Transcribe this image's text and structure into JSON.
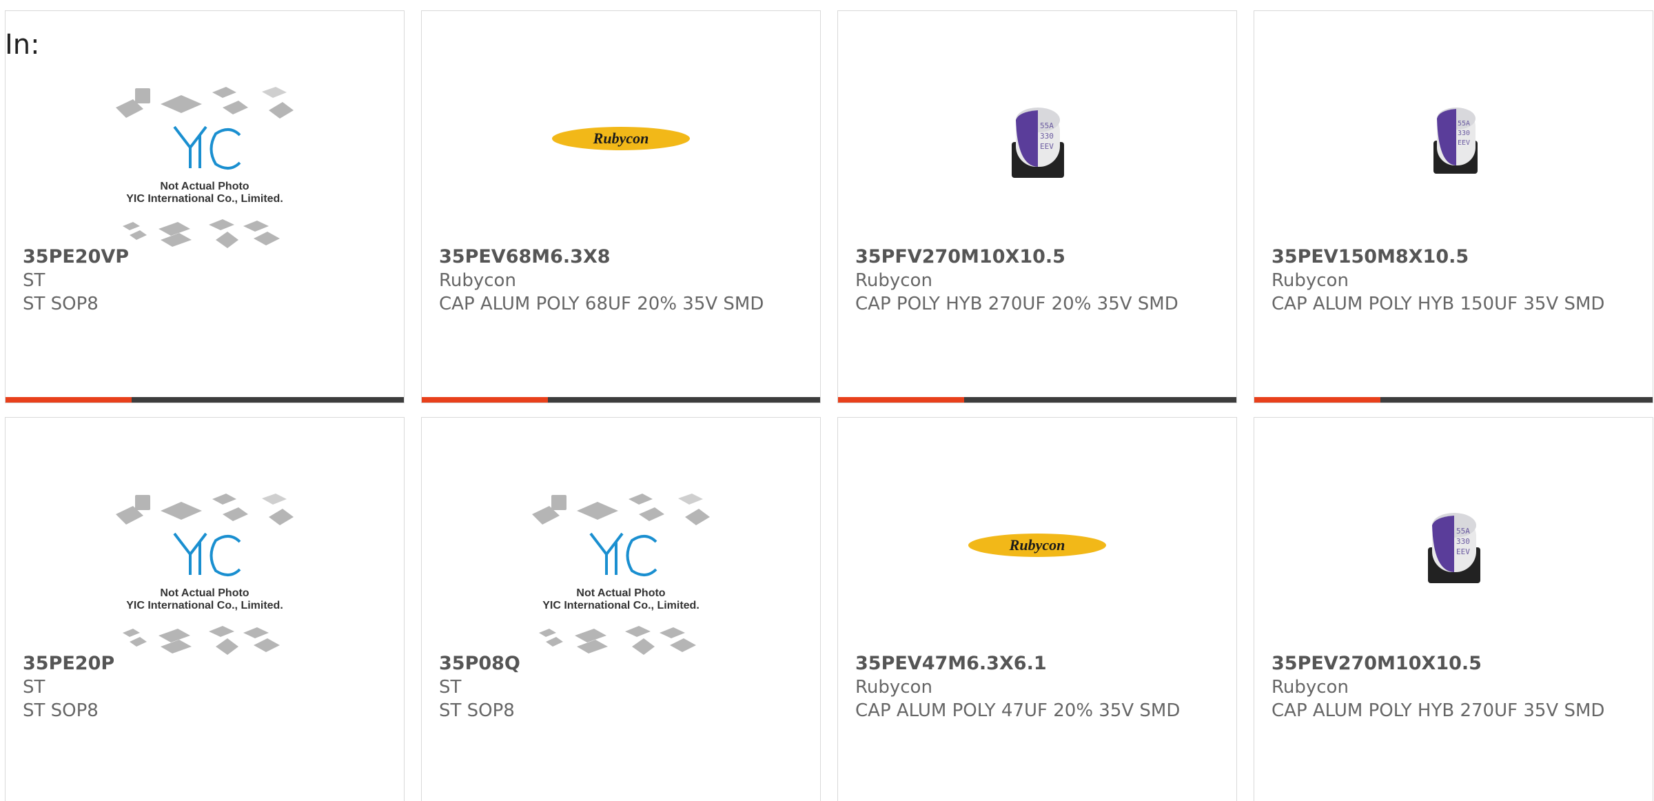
{
  "filter": {
    "label": "In:"
  },
  "cards": [
    {
      "part": "35PE20VP",
      "maker": "ST",
      "desc": "ST SOP8",
      "image": "not-actual-photo",
      "placeholder": {
        "line1": "Not Actual Photo",
        "line2": "YIC International Co., Limited."
      }
    },
    {
      "part": "35PEV68M6.3X8",
      "maker": "Rubycon",
      "desc": "CAP ALUM POLY 68UF 20% 35V SMD",
      "image": "rubycon-logo",
      "logo_text": "Rubycon"
    },
    {
      "part": "35PFV270M10X10.5",
      "maker": "Rubycon",
      "desc": "CAP POLY HYB 270UF 20% 35V SMD",
      "image": "capacitor-photo"
    },
    {
      "part": "35PEV150M8X10.5",
      "maker": "Rubycon",
      "desc": "CAP ALUM POLY HYB 150UF 35V SMD",
      "image": "capacitor-photo"
    },
    {
      "part": "35PE20P",
      "maker": "ST",
      "desc": "ST SOP8",
      "image": "not-actual-photo",
      "placeholder": {
        "line1": "Not Actual Photo",
        "line2": "YIC International Co., Limited."
      }
    },
    {
      "part": "35P08Q",
      "maker": "ST",
      "desc": "ST SOP8",
      "image": "not-actual-photo",
      "placeholder": {
        "line1": "Not Actual Photo",
        "line2": "YIC International Co., Limited."
      }
    },
    {
      "part": "35PEV47M6.3X6.1",
      "maker": "Rubycon",
      "desc": "CAP ALUM POLY 47UF 20% 35V SMD",
      "image": "rubycon-logo",
      "logo_text": "Rubycon"
    },
    {
      "part": "35PEV270M10X10.5",
      "maker": "Rubycon",
      "desc": "CAP ALUM POLY HYB 270UF 35V SMD",
      "image": "capacitor-photo"
    }
  ],
  "colors": {
    "accent": "#e8401b",
    "bar_dark": "#3d3d3d",
    "yic_blue": "#1a8fd0",
    "rubycon_yellow": "#f2b818",
    "cap_purple": "#5a3d9a"
  }
}
